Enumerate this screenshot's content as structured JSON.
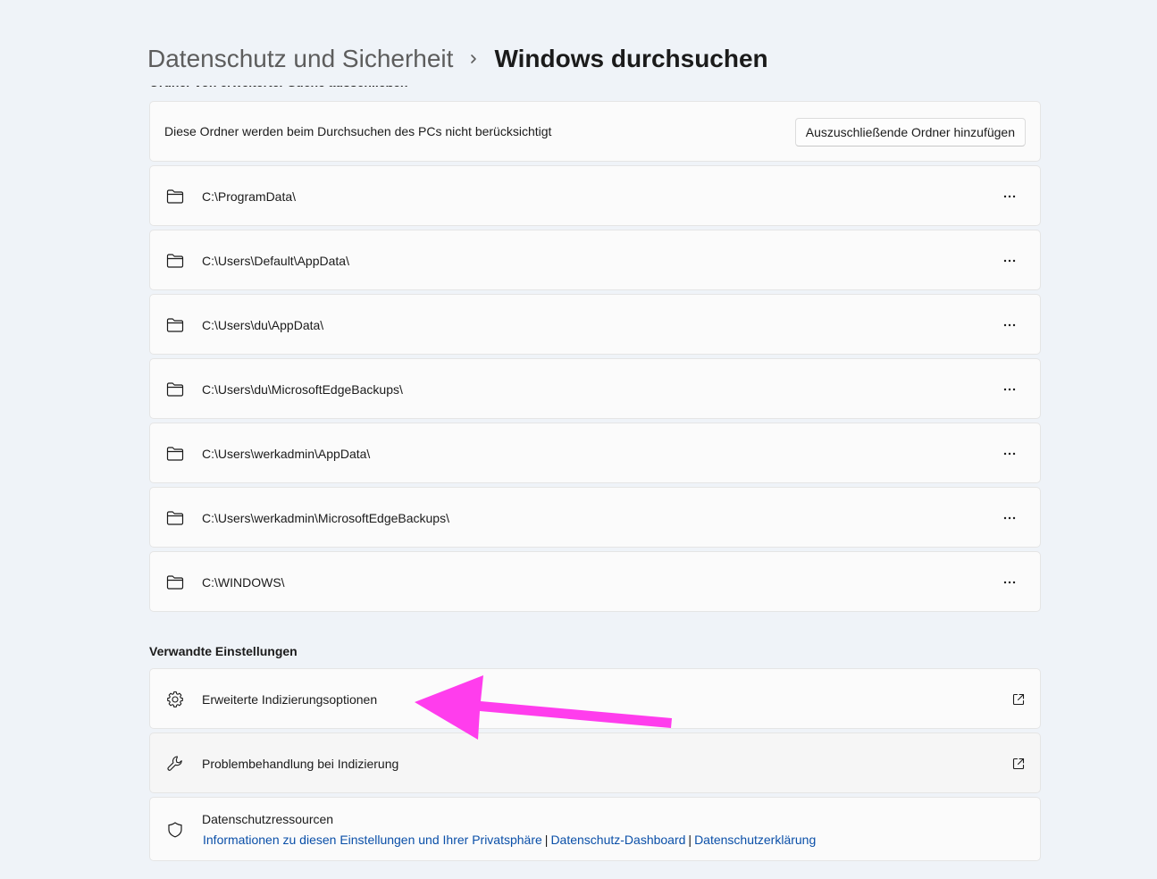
{
  "breadcrumb": {
    "parent": "Datenschutz und Sicherheit",
    "separator_icon": "chevron-right-icon",
    "current": "Windows durchsuchen"
  },
  "exclude_section": {
    "heading": "Ordner von erweiterter Suche ausschließen",
    "info_text": "Diese Ordner werden beim Durchsuchen des PCs nicht berücksichtigt",
    "add_button": "Auszuschließende Ordner hinzufügen",
    "folder_icon": "folder-icon",
    "more_icon": "more-horizontal-icon",
    "folders": [
      "C:\\ProgramData\\",
      "C:\\Users\\Default\\AppData\\",
      "C:\\Users\\du\\AppData\\",
      "C:\\Users\\du\\MicrosoftEdgeBackups\\",
      "C:\\Users\\werkadmin\\AppData\\",
      "C:\\Users\\werkadmin\\MicrosoftEdgeBackups\\",
      "C:\\WINDOWS\\"
    ]
  },
  "related": {
    "title": "Verwandte Einstellungen",
    "items": [
      {
        "label": "Erweiterte Indizierungsoptionen",
        "icon": "gear-icon",
        "trailing_icon": "external-link-icon"
      },
      {
        "label": "Problembehandlung bei Indizierung",
        "icon": "wrench-icon",
        "trailing_icon": "external-link-icon"
      }
    ]
  },
  "privacy": {
    "title": "Datenschutzressourcen",
    "icon": "shield-icon",
    "links": [
      "Informationen zu diesen Einstellungen und Ihrer Privatsphäre",
      "Datenschutz-Dashboard",
      "Datenschutzerklärung"
    ]
  },
  "annotation": {
    "arrow_color": "#ff3ded",
    "arrow_icon": "pointer-arrow-icon"
  },
  "colors": {
    "background": "#eff3f8",
    "card": "#fbfbfb",
    "link": "#0a4fa8"
  }
}
